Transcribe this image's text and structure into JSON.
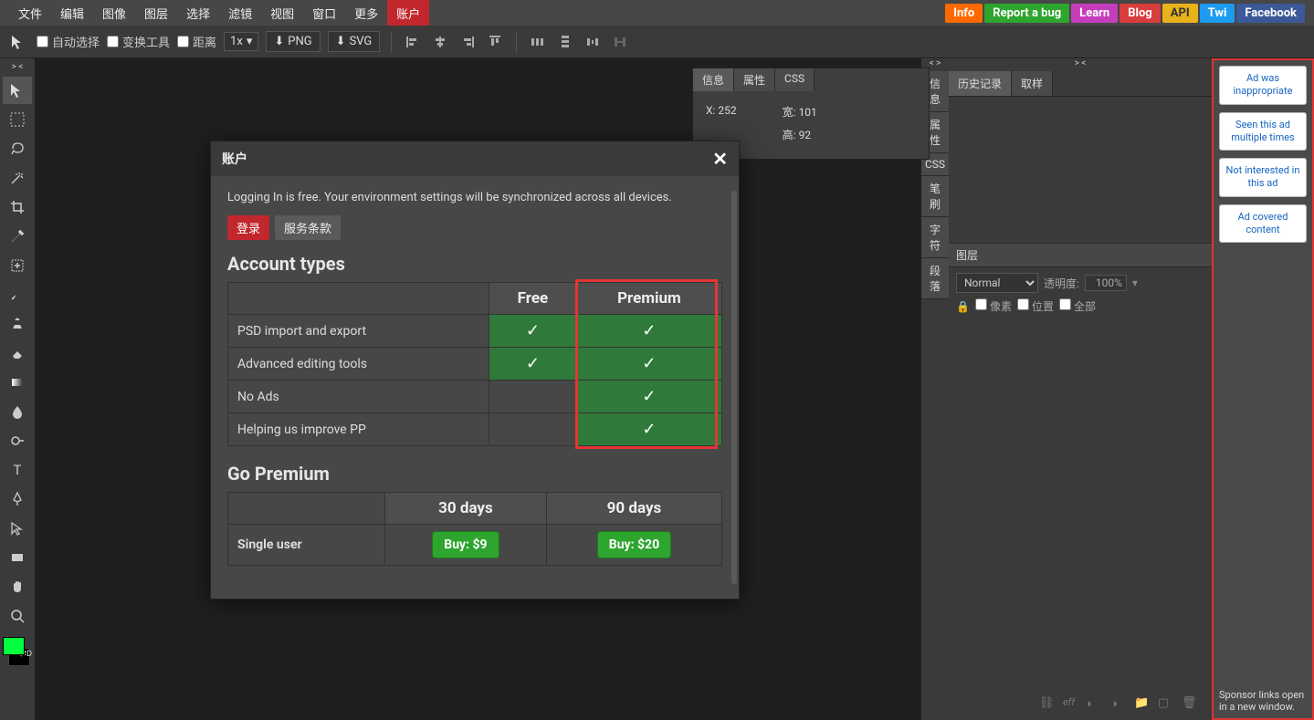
{
  "menubar": {
    "items": [
      "文件",
      "编辑",
      "图像",
      "图层",
      "选择",
      "滤镜",
      "视图",
      "窗口",
      "更多",
      "账户"
    ],
    "active_index": 9,
    "links": {
      "info": "Info",
      "bug": "Report a bug",
      "learn": "Learn",
      "blog": "Blog",
      "api": "API",
      "twi": "Twi",
      "fb": "Facebook"
    }
  },
  "toolbar": {
    "auto_select": "自动选择",
    "transform_tool": "变换工具",
    "distance": "距离",
    "zoom_level": "1x",
    "export_png": "PNG",
    "export_svg": "SVG"
  },
  "left_chevron": "> <",
  "info_panel": {
    "tabs": [
      "信息",
      "属性",
      "CSS"
    ],
    "x_label": "X:",
    "x_value": "252",
    "w_label": "宽:",
    "w_value": "101",
    "h_label": "高:",
    "h_value": "92"
  },
  "side_strip": {
    "chevron": "< >",
    "tabs": [
      "信息",
      "属性",
      "CSS",
      "笔刷",
      "字符",
      "段落"
    ]
  },
  "right_panel": {
    "chevron": "> <",
    "tabs": [
      "历史记录",
      "取样"
    ],
    "layer_section": "图层",
    "blend_mode": "Normal",
    "opacity_label": "透明度:",
    "opacity_value": "100%",
    "lock_pixel": "像素",
    "lock_position": "位置",
    "lock_all": "全部"
  },
  "layer_footer_icons": [
    "link",
    "fx",
    "mask",
    "adj",
    "group",
    "new",
    "trash"
  ],
  "ad_col": {
    "options": [
      "Ad was inappropriate",
      "Seen this ad multiple times",
      "Not interested in this ad",
      "Ad covered content"
    ],
    "sponsor_note": "Sponsor links open in a new window."
  },
  "modal": {
    "title": "账户",
    "intro": "Logging In is free. Your environment settings will be synchronized across all devices.",
    "tabs": [
      "登录",
      "服务条款"
    ],
    "active_tab": 0,
    "account_types_heading": "Account types",
    "col_free": "Free",
    "col_premium": "Premium",
    "features": [
      {
        "label": "PSD import and export",
        "free": true,
        "premium": true
      },
      {
        "label": "Advanced editing tools",
        "free": true,
        "premium": true
      },
      {
        "label": "No Ads",
        "free": false,
        "premium": true
      },
      {
        "label": "Helping us improve PP",
        "free": false,
        "premium": true
      }
    ],
    "go_premium_heading": "Go Premium",
    "duration_30": "30 days",
    "duration_90": "90 days",
    "single_user": "Single user",
    "buy_9": "Buy: $9",
    "buy_20": "Buy: $20"
  },
  "layer_footer_eff": "eff"
}
